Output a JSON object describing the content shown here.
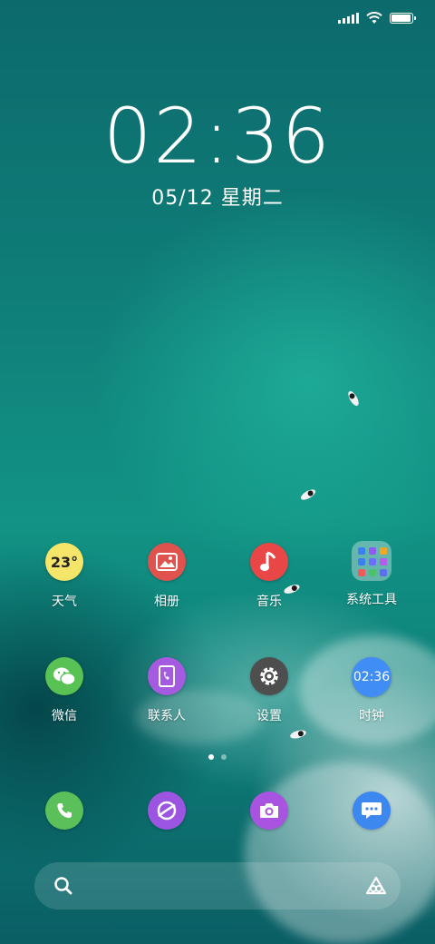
{
  "status_bar": {
    "signal_icon": "signal-bars-icon",
    "wifi_icon": "wifi-icon",
    "battery_icon": "battery-icon",
    "battery_level": 0.95
  },
  "lock_clock": {
    "time": "02:36",
    "date": "05/12 星期二"
  },
  "apps": [
    {
      "label": "天气",
      "icon": "weather-icon",
      "badge_text": "23°",
      "color": "#f5e66a"
    },
    {
      "label": "相册",
      "icon": "gallery-icon",
      "color": "#e0524e"
    },
    {
      "label": "音乐",
      "icon": "music-icon",
      "color": "#e94747"
    },
    {
      "label": "系统工具",
      "icon": "folder-icon"
    },
    {
      "label": "微信",
      "icon": "wechat-icon",
      "color": "#58c255"
    },
    {
      "label": "联系人",
      "icon": "contacts-icon",
      "color": "#a45be0"
    },
    {
      "label": "设置",
      "icon": "gear-icon",
      "color": "#4e4e4e"
    },
    {
      "label": "时钟",
      "icon": "clock-icon",
      "badge_text": "02:36",
      "color": "#3f8df5"
    }
  ],
  "dock": [
    {
      "icon": "phone-icon",
      "color": "#5cc05a"
    },
    {
      "icon": "browser-icon",
      "color": "#9b55e0"
    },
    {
      "icon": "camera-icon",
      "color": "#a954e0"
    },
    {
      "icon": "messages-icon",
      "color": "#3c87f0"
    }
  ],
  "page_indicator": {
    "count": 2,
    "active": 0
  },
  "search_bar": {
    "search_icon": "search-icon",
    "assistant_icon": "assistant-icon"
  }
}
